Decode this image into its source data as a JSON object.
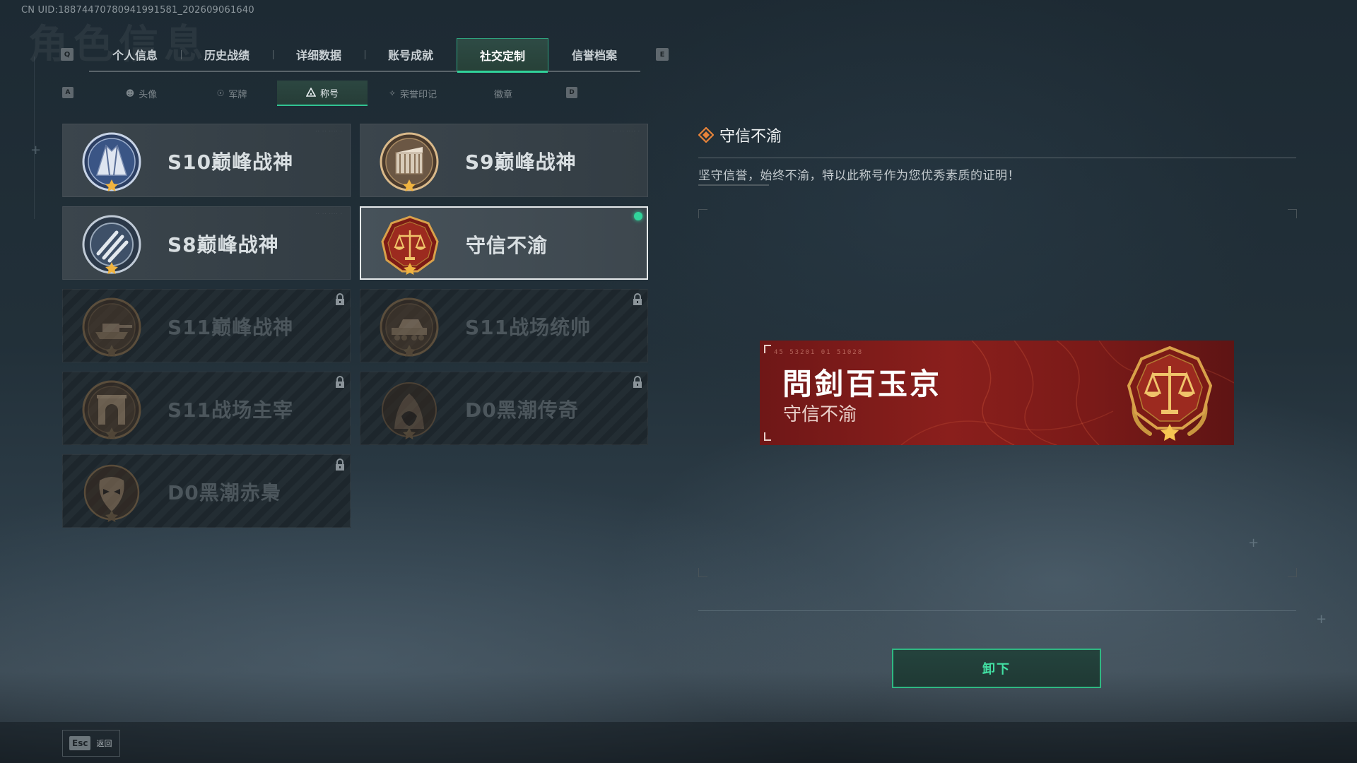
{
  "uid_text": "CN UID:18874470780941991581_202609061640",
  "bg_title": "角色信息",
  "tabs": {
    "prev_key": "Q",
    "next_key": "E",
    "items": [
      {
        "label": "个人信息"
      },
      {
        "label": "历史战绩"
      },
      {
        "label": "详细数据"
      },
      {
        "label": "账号成就"
      },
      {
        "label": "社交定制"
      },
      {
        "label": "信誉档案"
      }
    ],
    "active_index": 4
  },
  "subtabs": {
    "prev_key": "A",
    "next_key": "D",
    "items": [
      {
        "label": "头像",
        "icon": "person-icon"
      },
      {
        "label": "军牌",
        "icon": "dogtag-icon"
      },
      {
        "label": "称号",
        "icon": "triangle-icon"
      },
      {
        "label": "荣誉印记",
        "icon": "wings-icon"
      },
      {
        "label": "徽章",
        "icon": ""
      }
    ],
    "active_index": 2
  },
  "titles": [
    {
      "label": "S10巅峰战神",
      "badge": "mountain-emblem-icon",
      "locked": false,
      "selected": false,
      "equipped": false
    },
    {
      "label": "S9巅峰战神",
      "badge": "ruins-emblem-icon",
      "locked": false,
      "selected": false,
      "equipped": false
    },
    {
      "label": "S8巅峰战神",
      "badge": "stripes-emblem-icon",
      "locked": false,
      "selected": false,
      "equipped": false
    },
    {
      "label": "守信不渝",
      "badge": "scales-emblem-icon",
      "locked": false,
      "selected": true,
      "equipped": true
    },
    {
      "label": "S11巅峰战神",
      "badge": "tank-emblem-icon",
      "locked": true,
      "selected": false,
      "equipped": false
    },
    {
      "label": "S11战场统帅",
      "badge": "apc-emblem-icon",
      "locked": true,
      "selected": false,
      "equipped": false
    },
    {
      "label": "S11战场主宰",
      "badge": "arch-emblem-icon",
      "locked": true,
      "selected": false,
      "equipped": false
    },
    {
      "label": "D0黑潮传奇",
      "badge": "hooded-emblem-icon",
      "locked": true,
      "selected": false,
      "equipped": false
    },
    {
      "label": "D0黑潮赤梟",
      "badge": "mask-emblem-icon",
      "locked": true,
      "selected": false,
      "equipped": false
    }
  ],
  "detail": {
    "title": "守信不渝",
    "description": "坚守信誉，始终不渝，特以此称号作为您优秀素质的证明！"
  },
  "banner": {
    "player_name": "問釗百玉京",
    "title": "守信不渝",
    "code_text": "45 53201 01 51028"
  },
  "actions": {
    "unequip_label": "卸下",
    "esc_key": "Esc",
    "back_label": "返回"
  },
  "colors": {
    "accent": "#31d39a",
    "banner_red": "#8a1f1c",
    "gold": "#d9a14a"
  }
}
